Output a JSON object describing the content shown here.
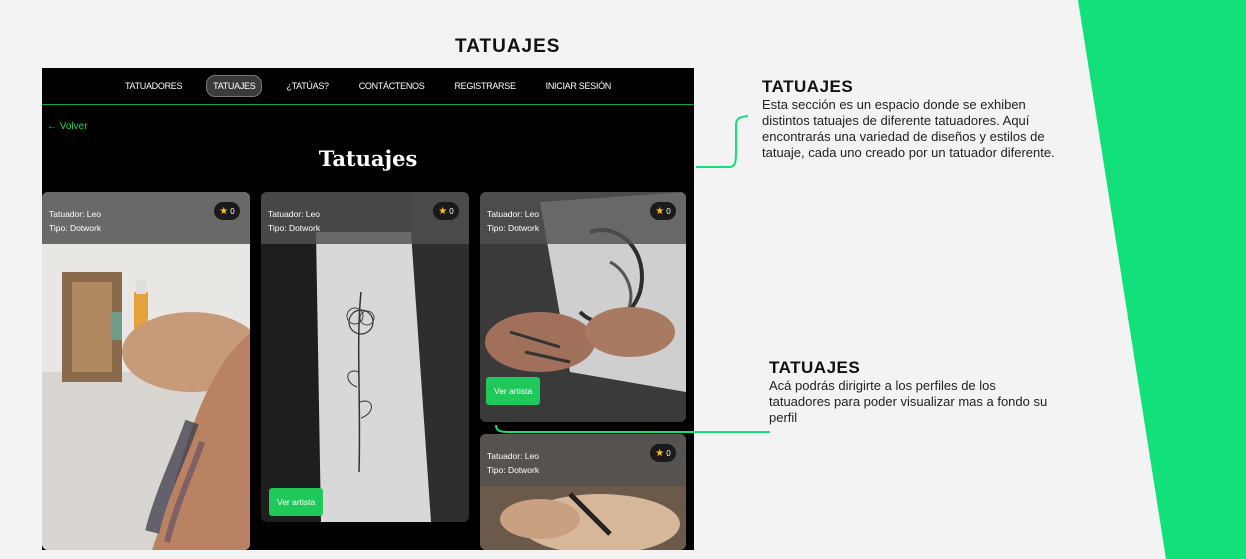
{
  "slide": {
    "title": "TATUAJES"
  },
  "app": {
    "nav": [
      "TATUADORES",
      "TATUAJES",
      "¿TATÚAS?",
      "CONTÁCTENOS",
      "REGISTRARSE",
      "INICIAR SESIÓN"
    ],
    "active_nav": "TATUAJES",
    "back_label": "Volver",
    "back_icon": "arrow-left-icon",
    "page_title": "Tatuajes",
    "cards": [
      {
        "artist": "Tatuador: Leo",
        "type": "Tipo: Dotwork",
        "stars": "0",
        "image": "arm-tattoo-photo"
      },
      {
        "artist": "Tatuador: Leo",
        "type": "Tipo: Dotwork",
        "stars": "0",
        "button": "Ver artista",
        "image": "flower-tattoo-photo"
      },
      {
        "artist": "Tatuador: Leo",
        "type": "Tipo: Dotwork",
        "stars": "0",
        "button": "Ver artista",
        "image": "back-tattoo-photo"
      },
      {
        "artist": "Tatuador: Leo",
        "type": "Tipo: Dotwork",
        "stars": "0",
        "image": "tattooing-hands-photo"
      }
    ],
    "star_icon": "star-icon"
  },
  "annotations": [
    {
      "title": "TATUAJES",
      "text": "Esta sección es un espacio donde se exhiben distintos tatuajes de diferente tatuadores. Aquí encontrarás una variedad de diseños y estilos de tatuaje, cada uno creado por un tatuador diferente."
    },
    {
      "title": "TATUAJES",
      "text": "Acá podrás dirigirte a los perfiles de los tatuadores para poder visualizar mas a fondo su perfil"
    }
  ],
  "colors": {
    "accent_green": "#12e07a",
    "button_green": "#1ec95a",
    "background": "#f3f3f3",
    "app_background": "#000000"
  }
}
